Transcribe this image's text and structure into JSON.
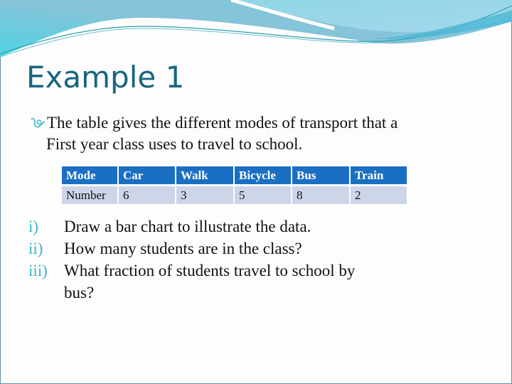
{
  "slide": {
    "title": "Example 1",
    "intro": {
      "icon": "curl-bullet-icon",
      "line1": "The table gives the different modes of transport that a",
      "line2": "First year class uses to travel to school."
    },
    "table": {
      "header": [
        "Mode",
        "Car",
        "Walk",
        "Bicycle",
        "Bus",
        "Train"
      ],
      "row": [
        "Number",
        "6",
        "3",
        "5",
        "8",
        "2"
      ]
    },
    "questions": [
      {
        "num": "i)",
        "text": "Draw a bar chart to illustrate the data."
      },
      {
        "num": "ii)",
        "text": "How many students are in the class?"
      },
      {
        "num": "iii)",
        "text": "What fraction of students travel to school by",
        "text2": "bus?"
      }
    ],
    "colors": {
      "title": "#17657e",
      "accent": "#3bb6c8",
      "table_header": "#1b6fc2",
      "table_body": "#cdd5e8"
    }
  }
}
